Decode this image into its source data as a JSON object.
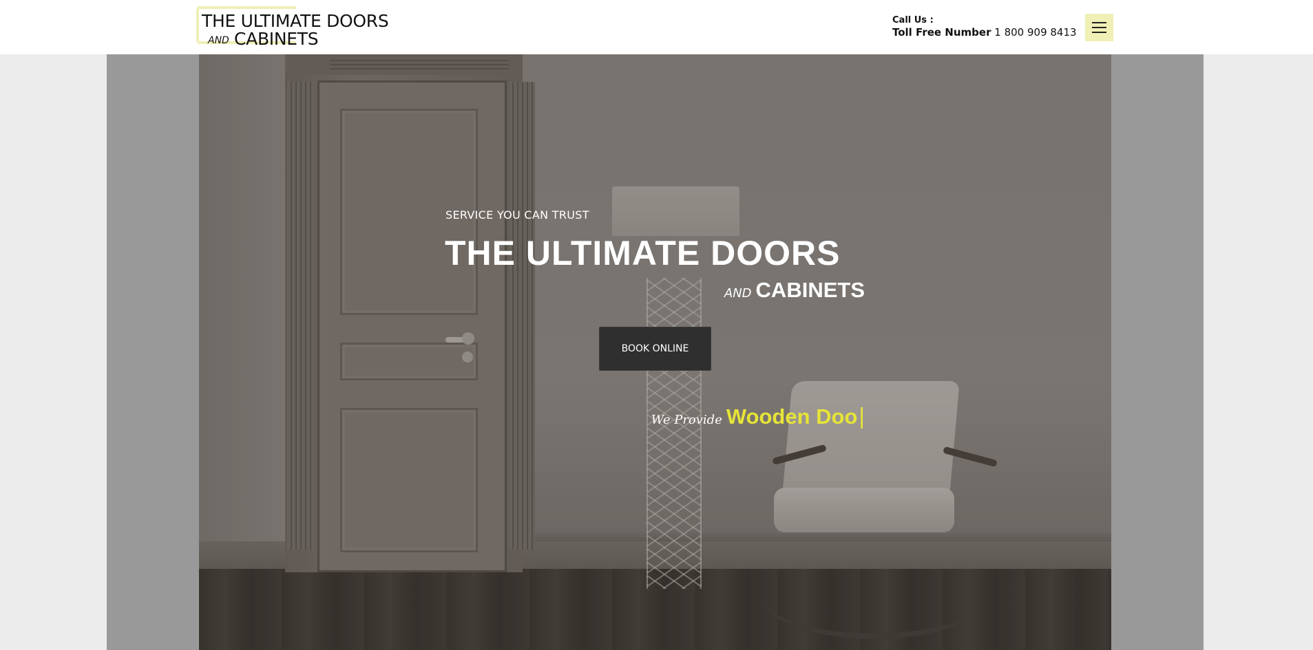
{
  "header": {
    "logo": {
      "line1": "THE ULTIMATE DOORS",
      "and": "AND",
      "line2": "CABINETS"
    },
    "contact": {
      "label": "Call Us :",
      "toll_free_label": "Toll Free Number",
      "phone": "1 800 909 8413"
    },
    "menu_icon": "hamburger-menu-icon"
  },
  "hero": {
    "kicker": "SERVICE YOU CAN TRUST",
    "title": "THE ULTIMATE DOORS",
    "subtitle_and": "AND",
    "subtitle_main": "CABINETS",
    "cta_label": "BOOK ONLINE",
    "typed_prefix": "We Provide",
    "typed_word": "Wooden Doo",
    "typed_cursor": "|"
  },
  "colors": {
    "accent_yellow": "#e6e438",
    "logo_bracket": "#efefb8",
    "menu_button_bg": "#f0f0b6",
    "cta_bg": "#2f2f2f"
  }
}
